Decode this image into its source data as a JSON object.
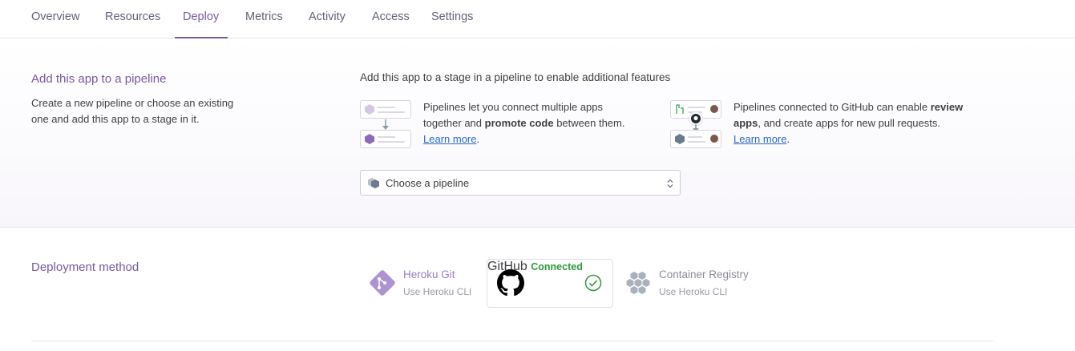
{
  "tabs": [
    {
      "label": "Overview"
    },
    {
      "label": "Resources"
    },
    {
      "label": "Deploy"
    },
    {
      "label": "Metrics"
    },
    {
      "label": "Activity"
    },
    {
      "label": "Access"
    },
    {
      "label": "Settings"
    }
  ],
  "pipeline": {
    "title": "Add this app to a pipeline",
    "desc_line1": "Create a new pipeline or choose an existing",
    "desc_line2": "one and add this app to a stage in it.",
    "feature_heading": "Add this app to a stage in a pipeline to enable additional features",
    "feature1": {
      "line1": "Pipelines let you connect multiple apps",
      "line2_a": "together and ",
      "line2_b": "promote code",
      "line2_c": " between them.",
      "link": "Learn more",
      "after_link": "."
    },
    "feature2": {
      "line1_a": "Pipelines connected to GitHub can enable ",
      "line1_b": "review",
      "line2_a": "apps",
      "line2_b": ", and create apps for new pull requests.",
      "link": "Learn more",
      "after_link": "."
    },
    "select": {
      "value": "Choose a pipeline"
    }
  },
  "deployment": {
    "title": "Deployment method",
    "methods": [
      {
        "name": "Heroku Git",
        "sub": "Use Heroku CLI"
      },
      {
        "name": "GitHub",
        "sub": "Connected"
      },
      {
        "name": "Container Registry",
        "sub": "Use Heroku CLI"
      }
    ]
  },
  "colors": {
    "accent": "#79589f",
    "connected": "#2e9a3e",
    "link": "#2b6bc7"
  }
}
